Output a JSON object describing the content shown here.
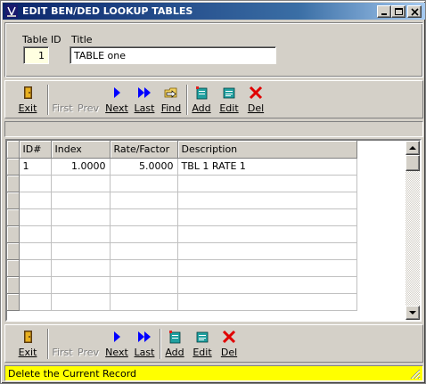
{
  "window": {
    "title": "EDIT BEN/DED LOOKUP TABLES",
    "title_bar_color": "#0a246a"
  },
  "header": {
    "table_id_label": "Table ID",
    "table_id_value": "1",
    "title_label": "Title",
    "title_value": "TABLE one"
  },
  "toolbar": {
    "exit": "Exit",
    "first": "First",
    "prev": "Prev",
    "next": "Next",
    "last": "Last",
    "find": "Find",
    "add": "Add",
    "edit": "Edit",
    "del": "Del"
  },
  "grid": {
    "columns": [
      "ID#",
      "Index",
      "Rate/Factor",
      "Description"
    ],
    "rows": [
      [
        "1",
        "1.0000",
        "5.0000",
        "TBL 1 RATE 1"
      ]
    ]
  },
  "status": {
    "text": "Delete the Current Record",
    "color": "#ffff00"
  }
}
